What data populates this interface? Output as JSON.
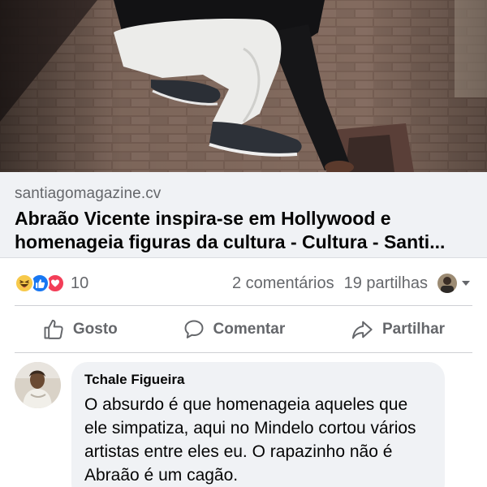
{
  "link_preview": {
    "domain": "santiagomagazine.cv",
    "title": "Abraão Vicente inspira-se em Hollywood e homenageia figuras da cultura - Cultura - Santi..."
  },
  "reactions": {
    "types": [
      "haha",
      "like",
      "love"
    ],
    "count": "10",
    "comments": "2 comentários",
    "shares": "19 partilhas"
  },
  "actions": {
    "like_label": "Gosto",
    "comment_label": "Comentar",
    "share_label": "Partilhar"
  },
  "comment": {
    "author": "Tchale Figueira",
    "text": "O absurdo é que homenageia aqueles que ele simpatiza, aqui no Mindelo cortou vários artistas entre eles eu. O rapazinho não é Abraão é um cagão."
  },
  "colors": {
    "accent_blue": "#1877f2",
    "love_red": "#f33e58",
    "haha_yellow": "#f7c94a",
    "secondary_text": "#65676b",
    "bubble_bg": "#f0f2f5"
  },
  "icons": {
    "like": "thumbs-up-icon",
    "comment": "speech-bubble-icon",
    "share": "share-arrow-icon",
    "caret": "caret-down-icon"
  }
}
